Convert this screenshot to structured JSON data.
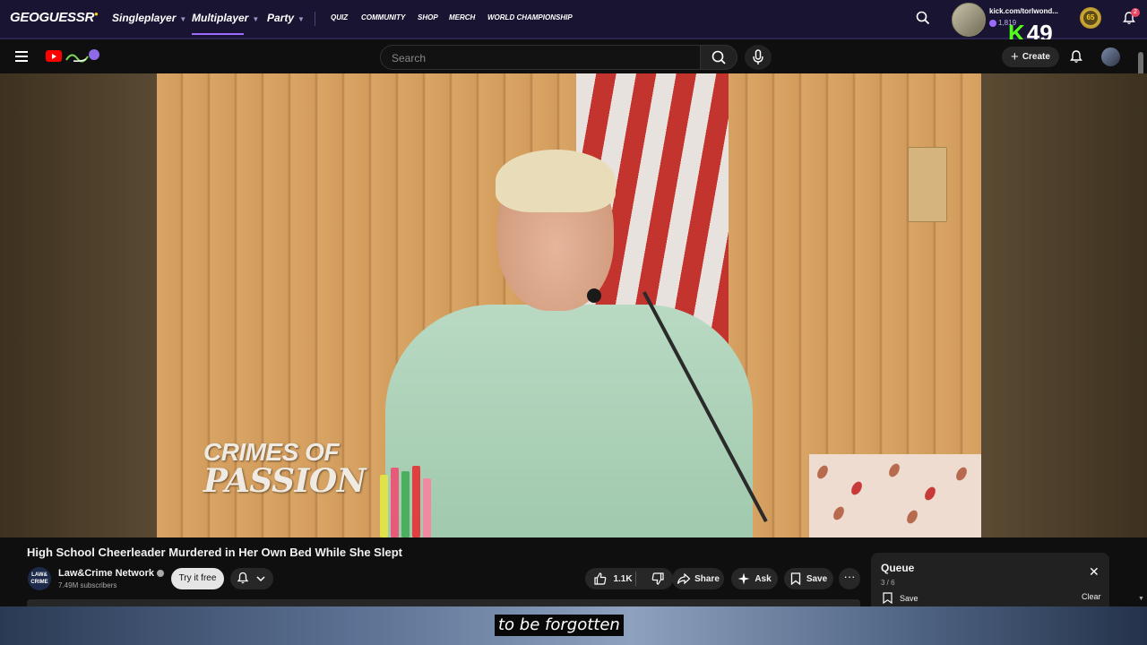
{
  "overlay": {
    "geoguessr": {
      "logo": "GEOGUESSR",
      "nav": [
        {
          "label": "Singleplayer",
          "active": false
        },
        {
          "label": "Multiplayer",
          "active": true
        },
        {
          "label": "Party",
          "active": false
        }
      ],
      "small_nav": [
        "QUIZ",
        "COMMUNITY",
        "SHOP",
        "MERCH",
        "WORLD CHAMPIONSHIP"
      ],
      "username": "kick.com/torlwond...",
      "coins": "1,819",
      "level": "65",
      "notification_count": "2",
      "accent": "#9c6cff"
    },
    "kick": {
      "letter": "K",
      "number": "49",
      "color": "#53fc18"
    }
  },
  "youtube": {
    "search": {
      "placeholder": "Search"
    },
    "create_label": "Create",
    "video": {
      "watermark_line1": "CRIMES OF",
      "watermark_line2": "PASSION",
      "title": "High School Cheerleader Murdered in Her Own Bed While She Slept"
    },
    "channel": {
      "avatar_text": "LAW& CRIME",
      "name": "Law&Crime Network",
      "subscribers": "7.49M subscribers",
      "join_label": "Try it free"
    },
    "actions": {
      "likes": "1.1K",
      "share": "Share",
      "ask": "Ask",
      "save": "Save"
    },
    "queue": {
      "title": "Queue",
      "position": "3 / 6",
      "save": "Save",
      "clear": "Clear"
    },
    "caption": "to be forgotten"
  }
}
